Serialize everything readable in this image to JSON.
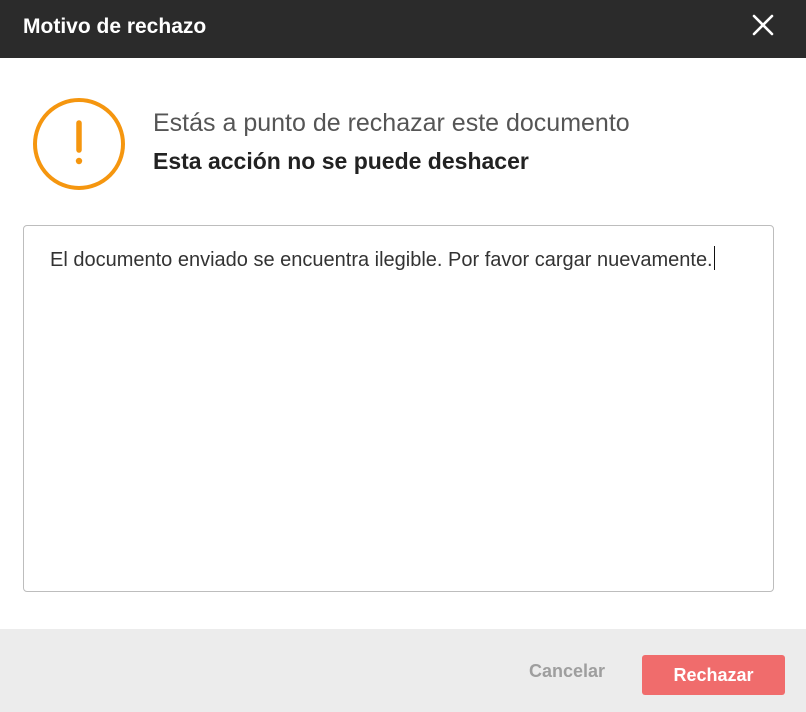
{
  "dialog": {
    "title": "Motivo de rechazo",
    "close_icon": "close-icon"
  },
  "warning": {
    "icon": "exclamation-circle-icon",
    "color": "#f5960f",
    "line1": "Estás a punto de rechazar este documento",
    "line2": "Esta acción no se puede deshacer"
  },
  "reason": {
    "value": "El documento enviado se encuentra ilegible. Por favor cargar nuevamente."
  },
  "footer": {
    "cancel_label": "Cancelar",
    "reject_label": "Rechazar",
    "reject_color": "#f06c6c"
  }
}
